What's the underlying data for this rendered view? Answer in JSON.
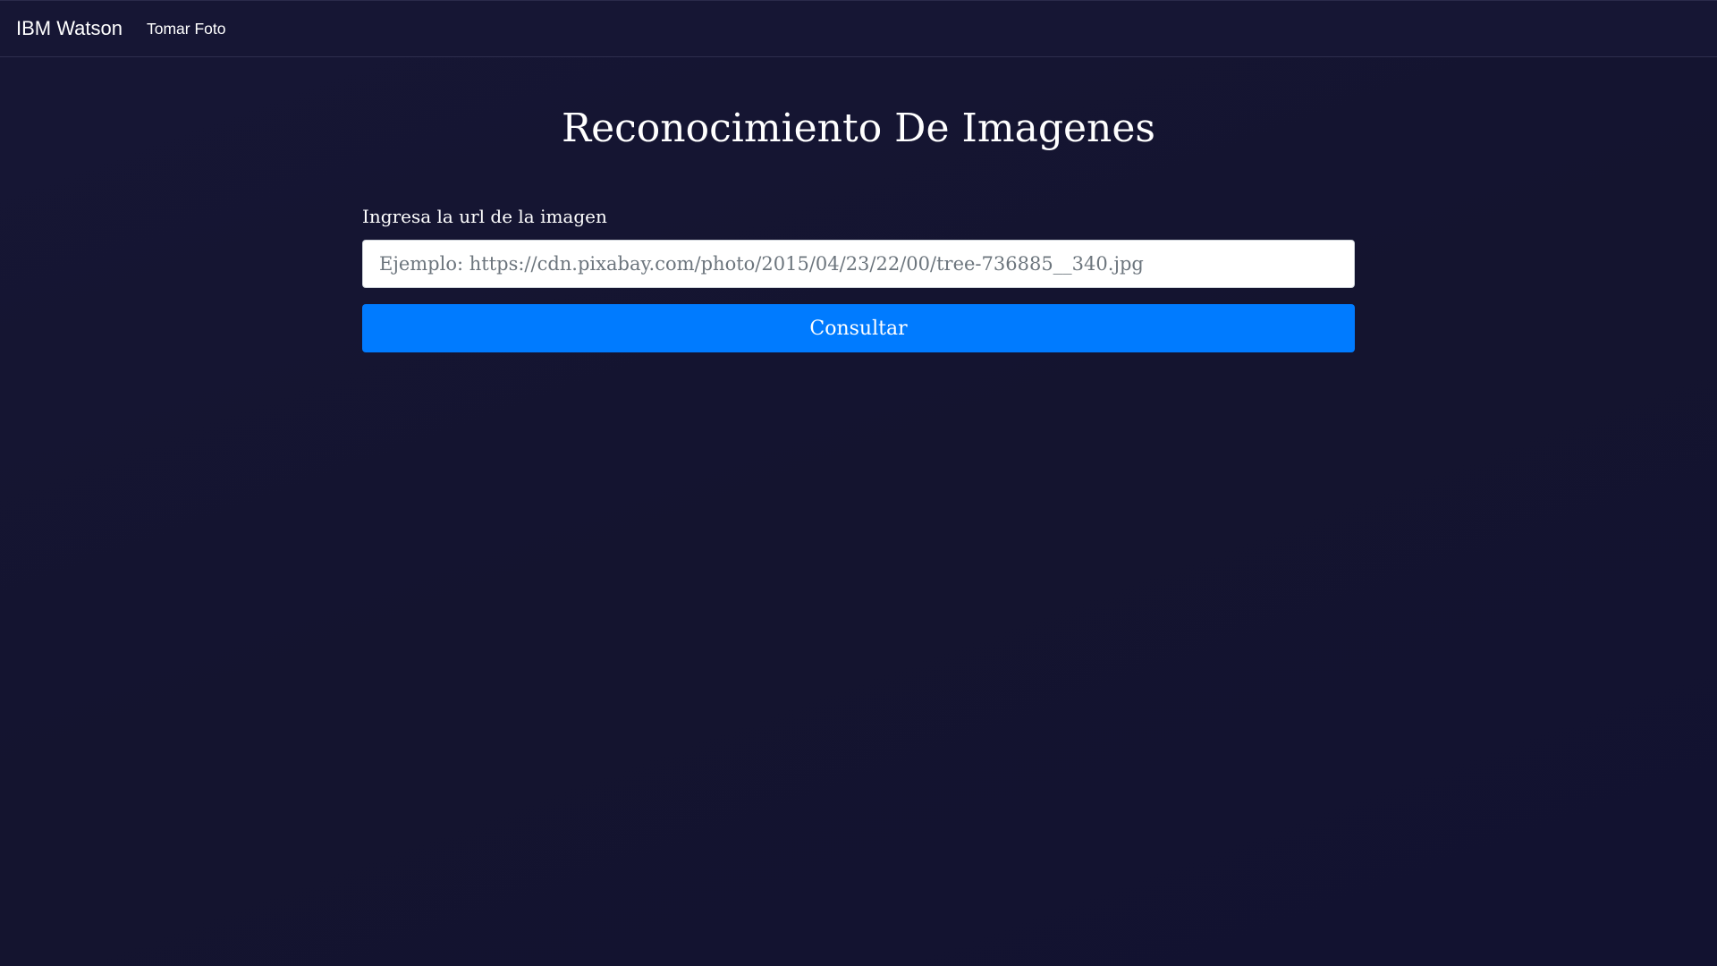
{
  "navbar": {
    "brand": "IBM Watson",
    "links": [
      "Tomar Foto"
    ]
  },
  "main": {
    "title": "Reconocimiento De Imagenes",
    "form": {
      "label": "Ingresa la url de la imagen",
      "input_value": "",
      "input_placeholder": "Ejemplo: https://cdn.pixabay.com/photo/2015/04/23/22/00/tree-736885__340.jpg",
      "submit_label": "Consultar"
    }
  },
  "colors": {
    "background": "#141431",
    "navbar": "#161634",
    "primary_button": "#007bff",
    "text": "#ffffff"
  }
}
